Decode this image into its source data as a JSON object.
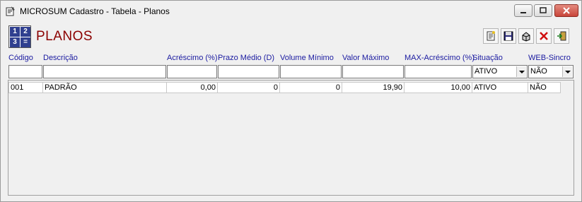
{
  "window": {
    "title": "MICROSUM Cadastro - Tabela - Planos",
    "controls": [
      "minimize",
      "maximize",
      "close"
    ]
  },
  "header": {
    "icon_digits": [
      "1",
      "2",
      "3",
      "="
    ],
    "title": "PLANOS"
  },
  "toolbar": {
    "buttons": [
      {
        "name": "new-record",
        "icon": "document-new-icon"
      },
      {
        "name": "save",
        "icon": "floppy-disk-icon"
      },
      {
        "name": "print",
        "icon": "printer-icon"
      },
      {
        "name": "delete",
        "icon": "red-x-icon"
      },
      {
        "name": "exit",
        "icon": "door-exit-icon"
      }
    ]
  },
  "columns": [
    "Código",
    "Descrição",
    "Acréscimo (%)",
    "Prazo Médio (D)",
    "Volume Mínimo",
    "Valor Máximo",
    "MAX-Acréscimo (%)",
    "Situação",
    "WEB-Sincro"
  ],
  "filters": {
    "codigo": "",
    "descricao": "",
    "acrescimo": "",
    "prazo": "",
    "volume": "",
    "valor": "",
    "max_acrescimo": "",
    "situacao": "ATIVO",
    "web_sincro": "NÃO"
  },
  "rows": [
    {
      "codigo": "001",
      "descricao": "PADRÃO",
      "acrescimo": "0,00",
      "prazo": "0",
      "volume": "0",
      "valor": "19,90",
      "max_acrescimo": "10,00",
      "situacao": "ATIVO",
      "web_sincro": "NÃO"
    }
  ],
  "colors": {
    "header_text": "#1a1aa0",
    "title_text": "#8b0000",
    "close_button": "#c8453a"
  }
}
